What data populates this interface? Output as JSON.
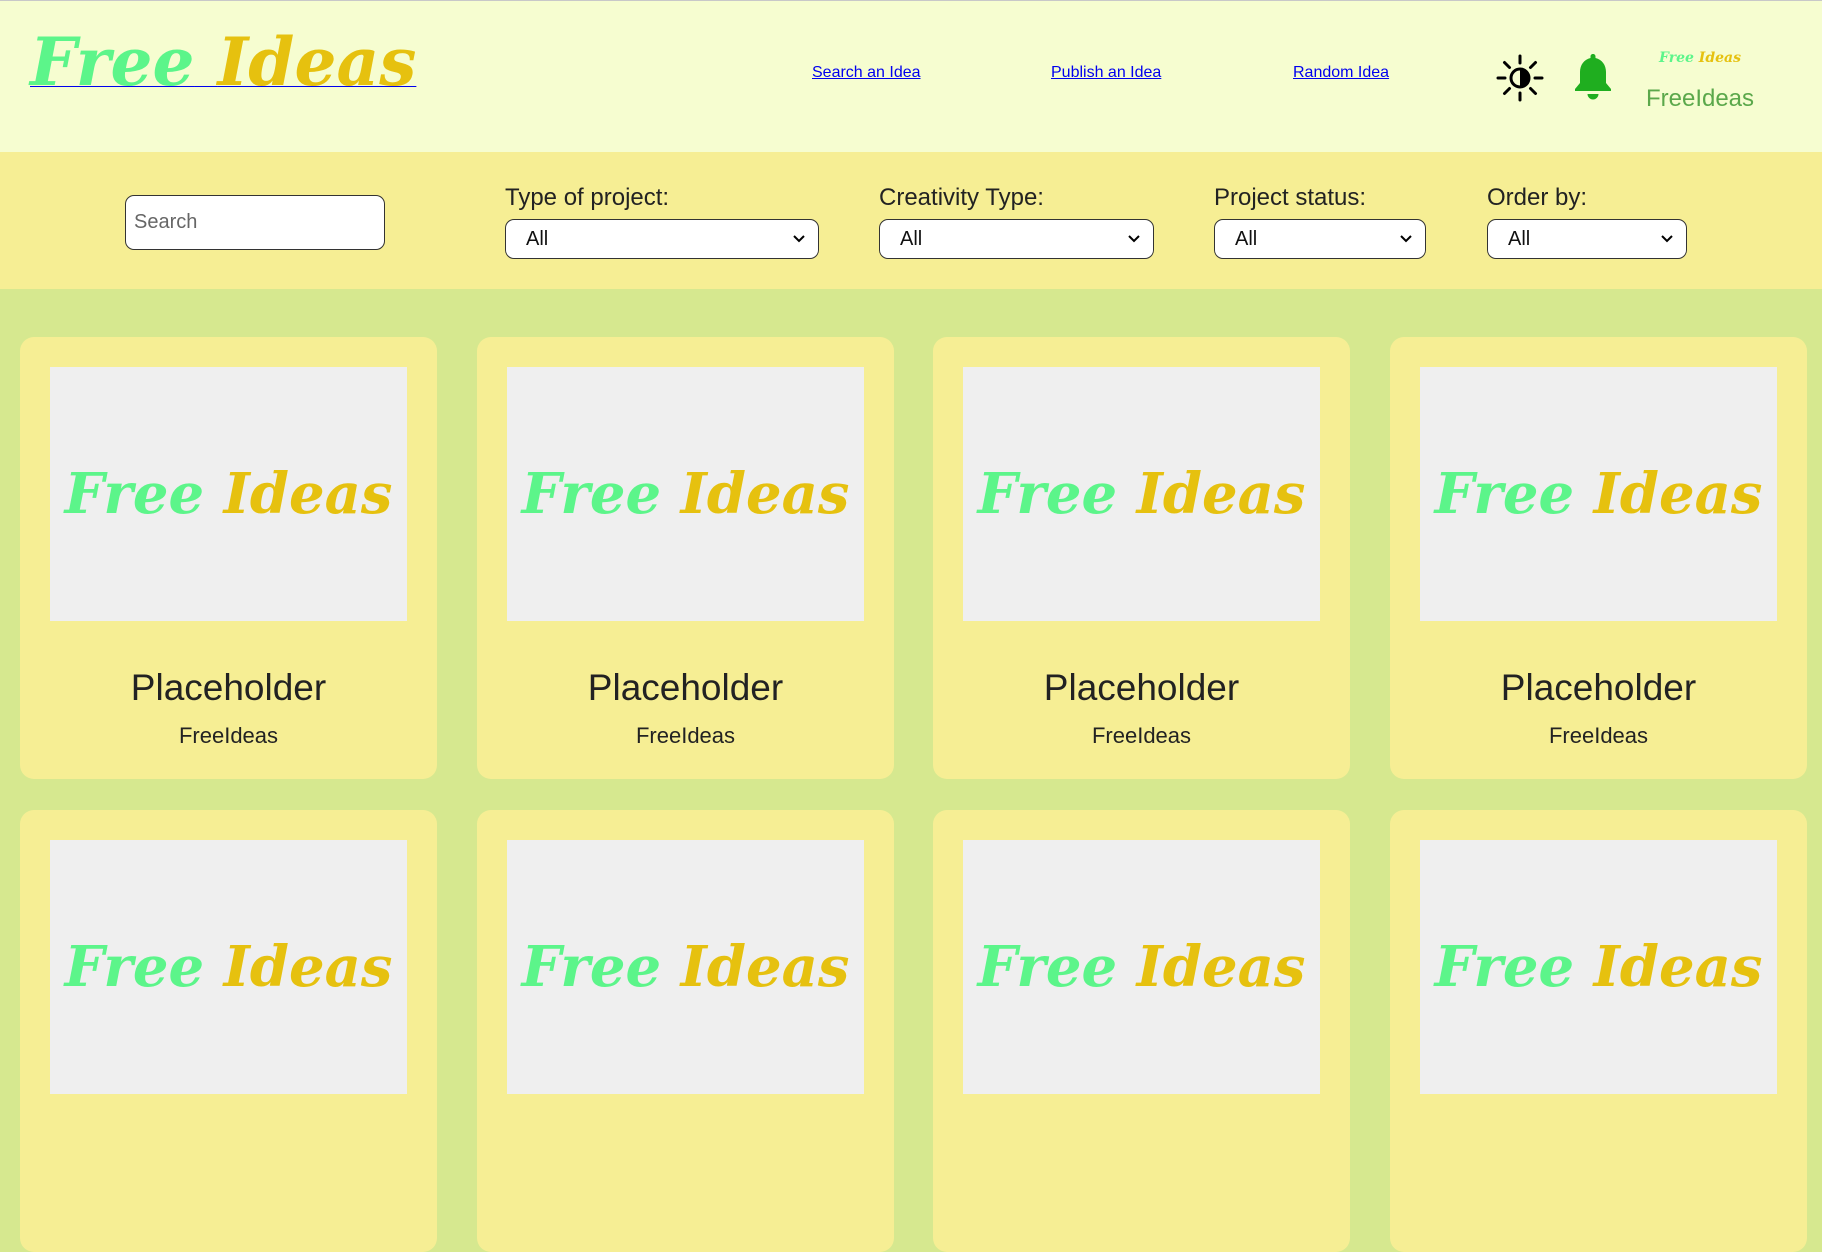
{
  "header": {
    "logo": {
      "part1": "Free",
      "part2": "Ideas"
    },
    "nav": [
      {
        "label": "Search an Idea"
      },
      {
        "label": "Publish an Idea"
      },
      {
        "label": "Random Idea"
      }
    ],
    "theme_icon": "brightness-icon",
    "bell_icon": "bell-icon",
    "user": {
      "avatar_logo": {
        "part1": "Free",
        "part2": "Ideas"
      },
      "name": "FreeIdeas"
    }
  },
  "filters": {
    "search": {
      "placeholder": "Search",
      "value": ""
    },
    "type_of_project": {
      "label": "Type of project:",
      "selected": "All"
    },
    "creativity_type": {
      "label": "Creativity Type:",
      "selected": "All"
    },
    "project_status": {
      "label": "Project status:",
      "selected": "All"
    },
    "order_by": {
      "label": "Order by:",
      "selected": "All"
    }
  },
  "cards": [
    {
      "title": "Placeholder",
      "author": "FreeIdeas",
      "image_logo": {
        "part1": "Free",
        "part2": "Ideas"
      }
    },
    {
      "title": "Placeholder",
      "author": "FreeIdeas",
      "image_logo": {
        "part1": "Free",
        "part2": "Ideas"
      }
    },
    {
      "title": "Placeholder",
      "author": "FreeIdeas",
      "image_logo": {
        "part1": "Free",
        "part2": "Ideas"
      }
    },
    {
      "title": "Placeholder",
      "author": "FreeIdeas",
      "image_logo": {
        "part1": "Free",
        "part2": "Ideas"
      }
    },
    {
      "title": "",
      "author": "",
      "image_logo": {
        "part1": "Free",
        "part2": "Ideas"
      }
    },
    {
      "title": "",
      "author": "",
      "image_logo": {
        "part1": "Free",
        "part2": "Ideas"
      }
    },
    {
      "title": "",
      "author": "",
      "image_logo": {
        "part1": "Free",
        "part2": "Ideas"
      }
    },
    {
      "title": "",
      "author": "",
      "image_logo": {
        "part1": "Free",
        "part2": "Ideas"
      }
    }
  ],
  "colors": {
    "header_bg": "#f6fdd0",
    "filters_bg": "#f6ee94",
    "page_bg": "#d6e88f",
    "card_bg": "#f6ee94",
    "accent_green": "#22b43c",
    "accent_yellow": "#ffd000",
    "user_name": "#5ba84b",
    "bell": "#1fae1f"
  }
}
